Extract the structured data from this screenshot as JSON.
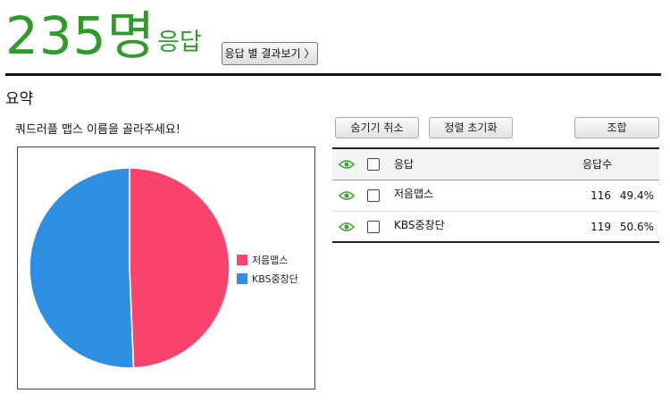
{
  "header": {
    "count": "235명",
    "count_label": "응답",
    "results_button": "응답 별 결과보기 〉"
  },
  "summary": {
    "title": "요약",
    "question": "쿼드러플 맵스 이름을 골라주세요!"
  },
  "toolbar": {
    "hide_cancel": "숨기기 취소",
    "sort_reset": "정렬 초기화",
    "combine": "조합"
  },
  "table": {
    "col_response": "응답",
    "col_count": "응답수",
    "rows": [
      {
        "label": "저음맵스",
        "count": "116",
        "percent": "49.4%"
      },
      {
        "label": "KBS중창단",
        "count": "119",
        "percent": "50.6%"
      }
    ]
  },
  "chart_data": {
    "type": "pie",
    "categories": [
      "저음맵스",
      "KBS중창단"
    ],
    "values": [
      116,
      119
    ],
    "colors": [
      "#fa446d",
      "#2f8fe2"
    ],
    "legend_position": "right"
  },
  "colors": {
    "accent_green": "#2e9c2a",
    "eye_green": "#4aa53b"
  }
}
